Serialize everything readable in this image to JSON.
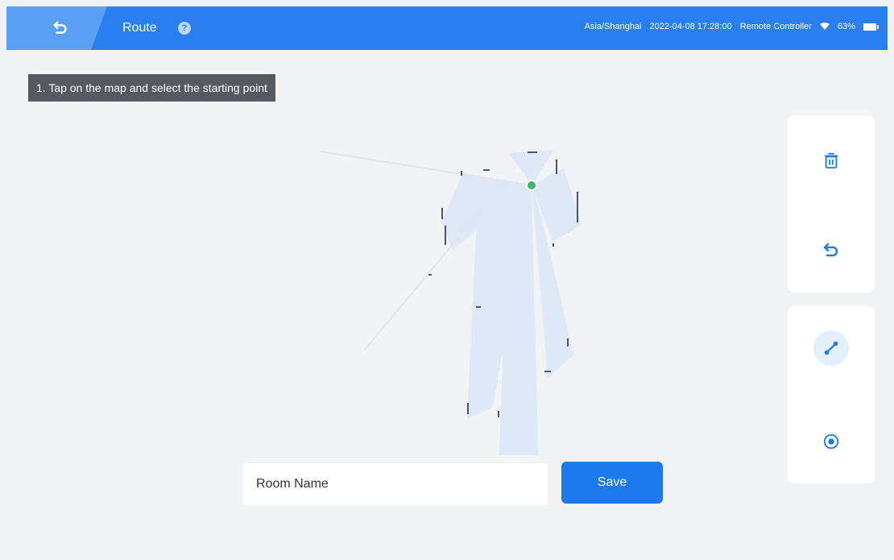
{
  "header": {
    "title": "Route",
    "help_icon": "?",
    "timezone": "Asia/Shanghai",
    "datetime": "2022-04-08 17:28:00",
    "controller_label": "Remote Controller",
    "battery_percent": "63%",
    "accent_color": "#2a7ff0"
  },
  "map": {
    "instruction": "1. Tap on the map and select the starting point"
  },
  "tools": {
    "top_panel": [
      "trash-icon",
      "undo-icon"
    ],
    "bottom_panel": [
      "line-route-icon",
      "point-target-icon"
    ],
    "active_tool": "line-route-icon"
  },
  "footer": {
    "room_placeholder": "Room Name",
    "save_label": "Save"
  }
}
